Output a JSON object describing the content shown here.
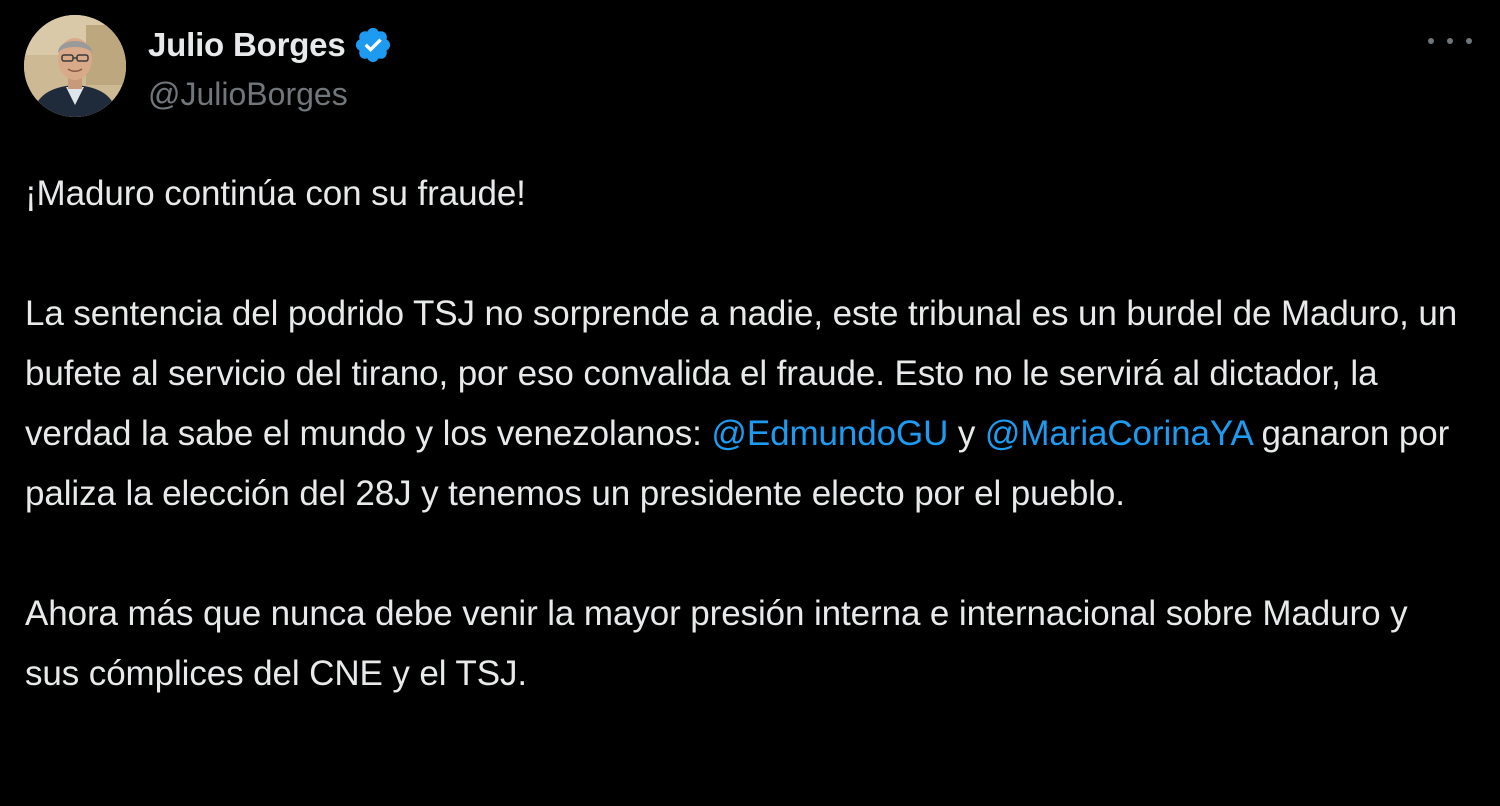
{
  "author": {
    "display_name": "Julio Borges",
    "handle": "@JulioBorges",
    "verified": true
  },
  "tweet": {
    "line_1": "¡Maduro continúa con su fraude!",
    "p2_a": "La sentencia del podrido TSJ no sorprende a nadie, este tribunal es un burdel de Maduro, un bufete al servicio del tirano, por eso convalida el fraude. Esto no le servirá al dictador, la verdad la sabe el mundo y los venezolanos: ",
    "mention_1": "@EdmundoGU",
    "p2_b": " y ",
    "mention_2": "@MariaCorinaYA",
    "p2_c": " ganaron por paliza la elección del 28J y tenemos un presidente electo por el pueblo.",
    "p3": "Ahora más que nunca debe venir la mayor presión interna e internacional sobre Maduro y sus cómplices del CNE y el TSJ."
  },
  "icons": {
    "verified": "verified-badge-icon",
    "more": "more-options-icon"
  },
  "colors": {
    "background": "#000000",
    "text": "#e7e9ea",
    "secondary_text": "#71767b",
    "mention": "#1d9bf0",
    "verified_badge": "#1d9bf0"
  }
}
